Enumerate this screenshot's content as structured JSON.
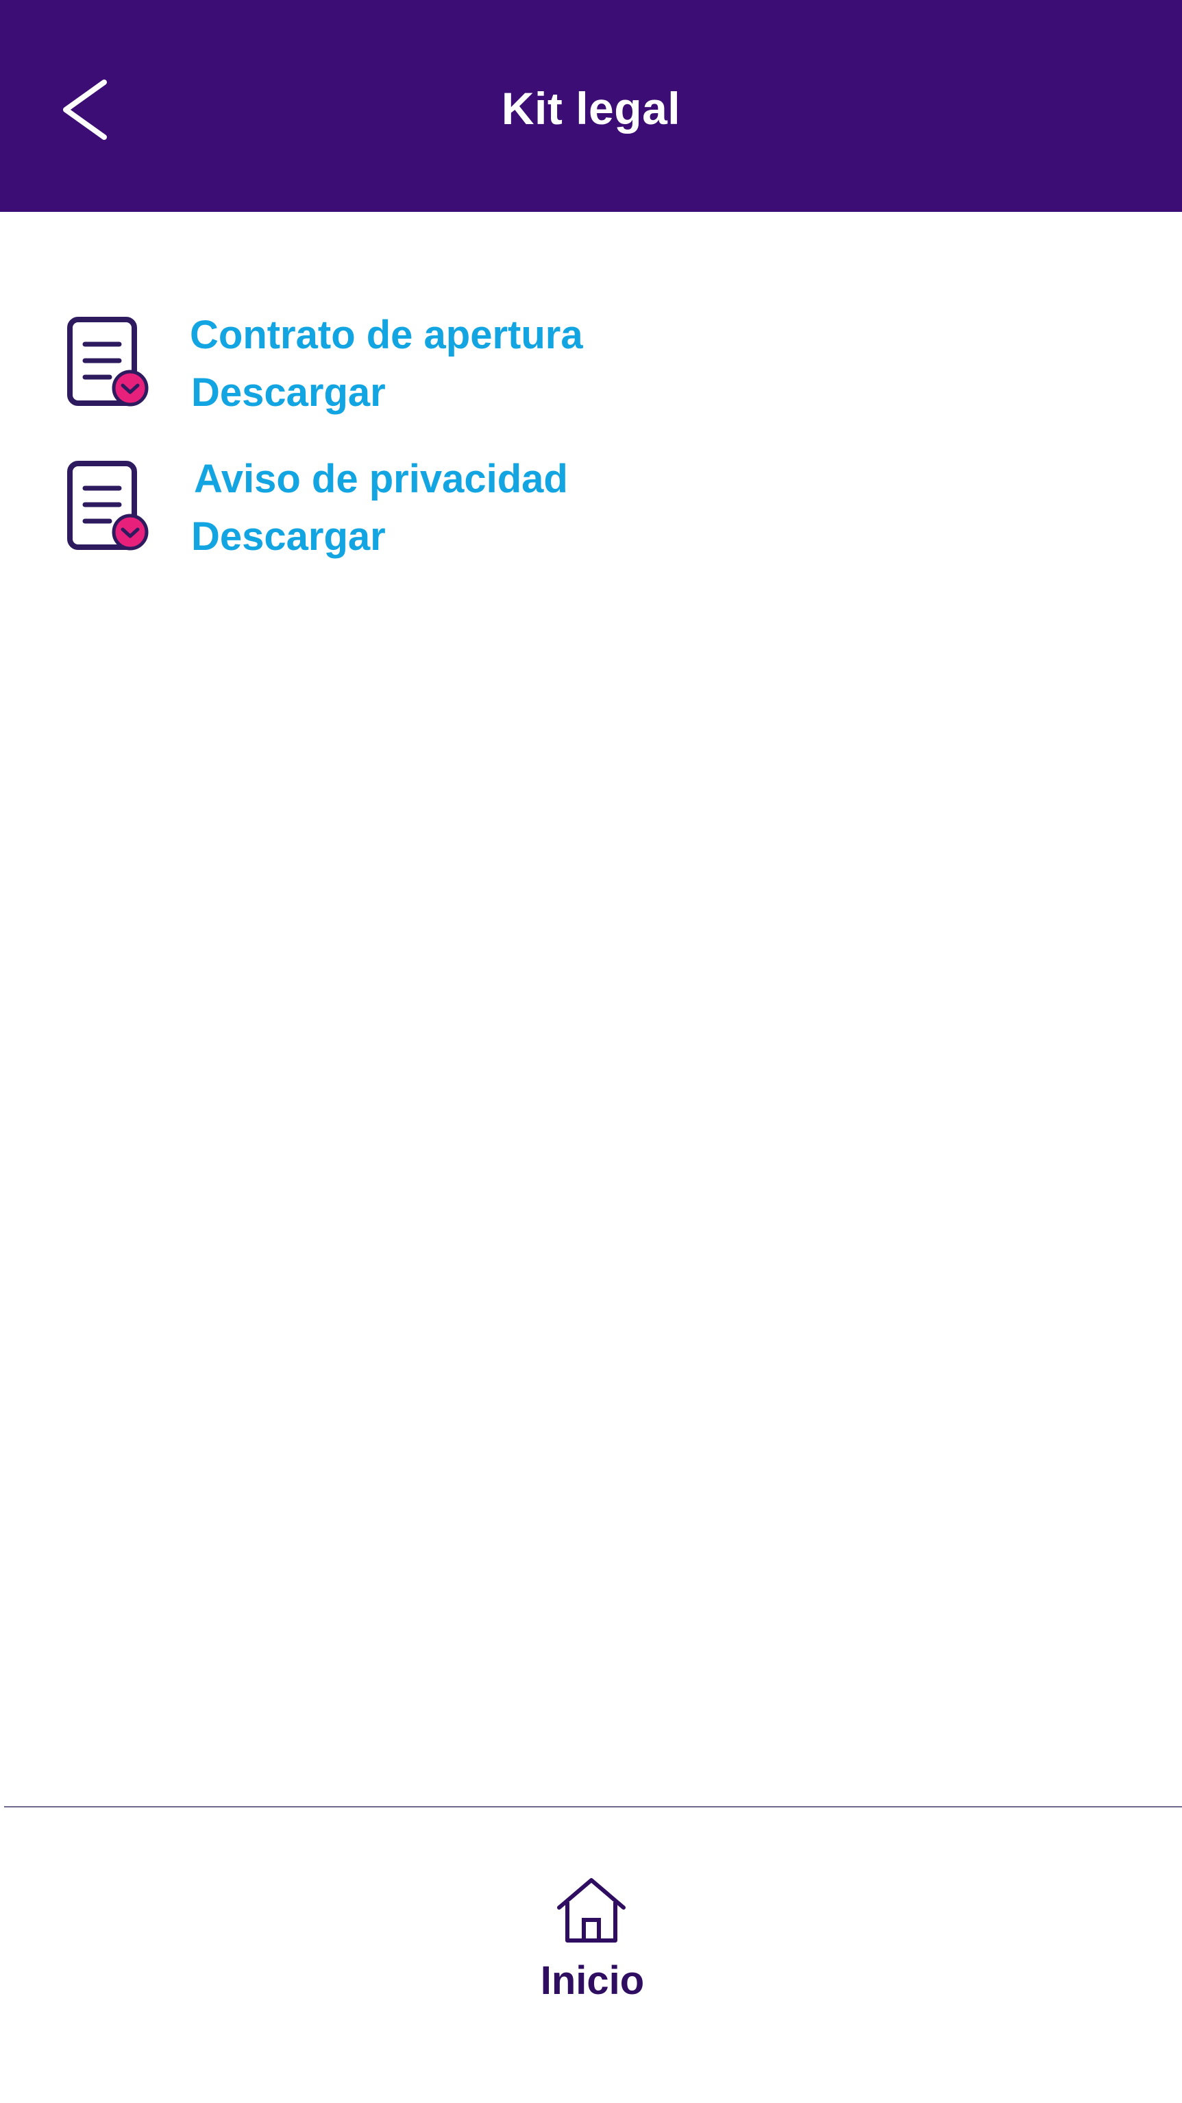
{
  "header": {
    "title": "Kit legal",
    "back_icon": "chevron-left-icon",
    "background_color": "#3c0e75"
  },
  "documents": [
    {
      "title": "Contrato de apertura",
      "action_label": "Descargar",
      "icon": "document-download-icon"
    },
    {
      "title": "Aviso de privacidad",
      "action_label": "Descargar",
      "icon": "document-download-icon"
    }
  ],
  "bottom_nav": {
    "items": [
      {
        "label": "Inicio",
        "icon": "home-icon"
      }
    ]
  },
  "colors": {
    "link": "#12a5e2",
    "icon_outline": "#2e1a5e",
    "badge": "#e7217b",
    "nav_text": "#2f0d61"
  }
}
